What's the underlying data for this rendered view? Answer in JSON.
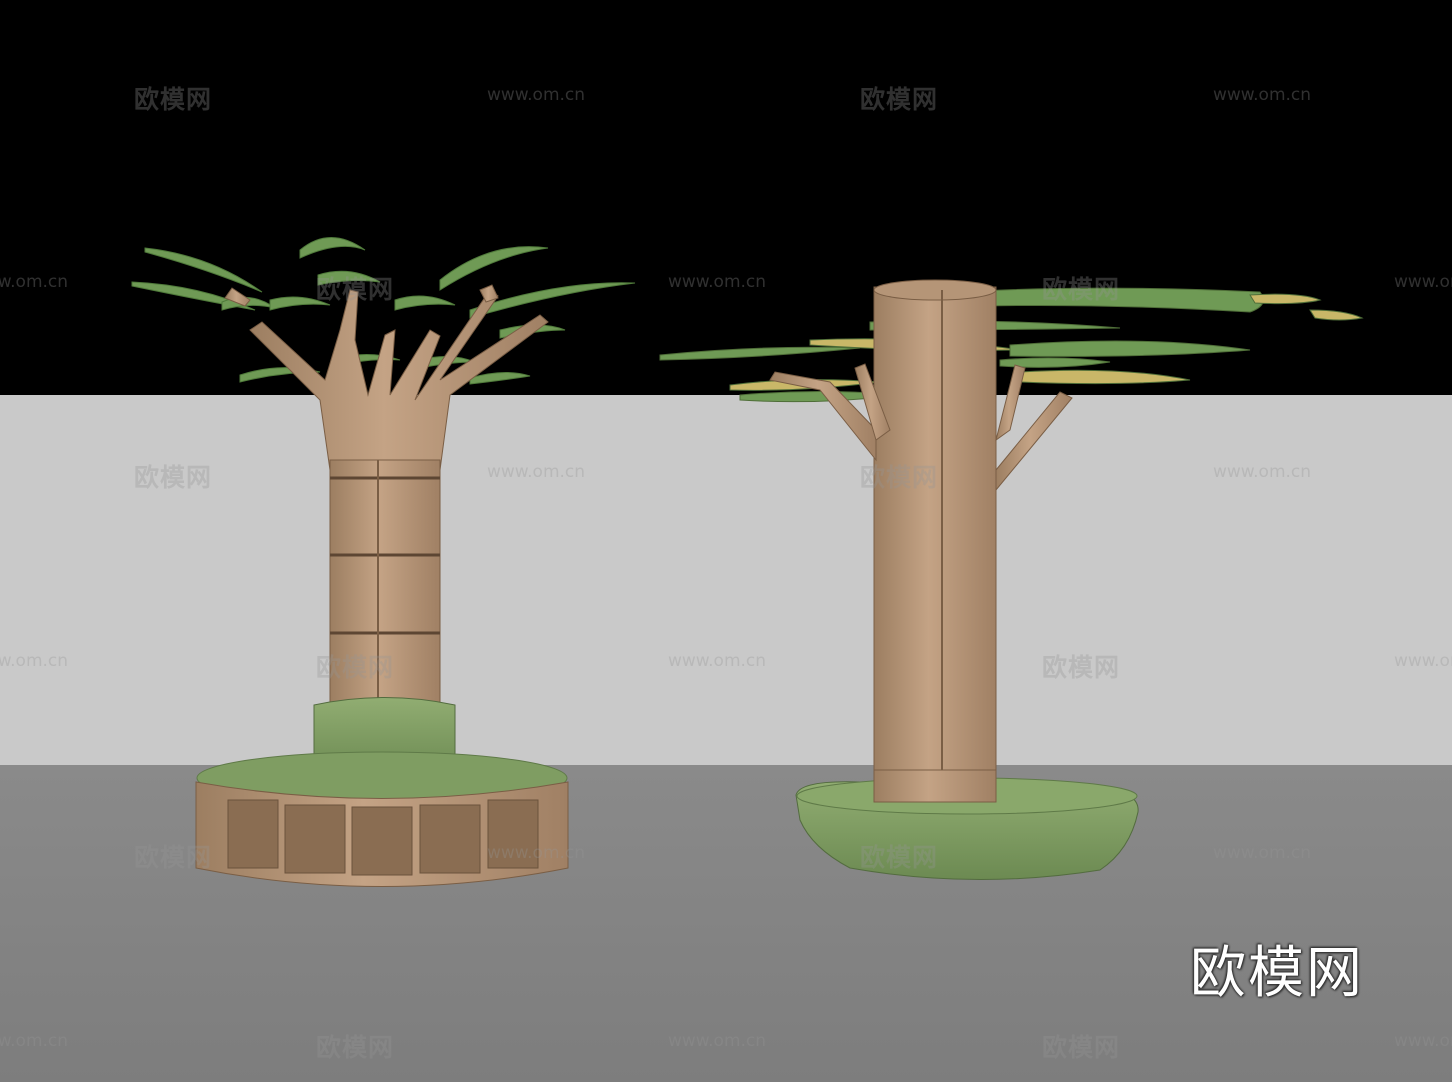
{
  "brand_logo": {
    "text": "欧模网",
    "color": "#ffffff"
  },
  "watermarks": {
    "cn_text": "欧模网",
    "url_text": "www.om.cn",
    "color": "rgba(150,150,150,0.32)"
  },
  "scene": {
    "colors": {
      "sky": "#000000",
      "wall": "#c9c9c9",
      "floor": "#858585",
      "wood": "#b9997a",
      "wood_dark": "#8a6d52",
      "leaf_green": "#6f9a55",
      "leaf_yellow": "#c9b768",
      "cushion": "#7f9d62"
    }
  }
}
